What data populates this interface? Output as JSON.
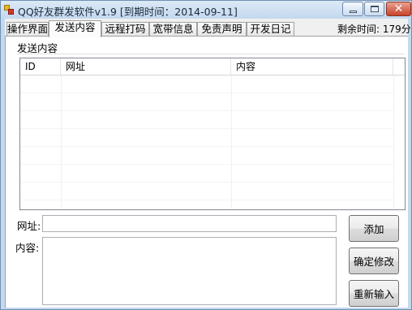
{
  "window": {
    "title": "QQ好友群发软件v1.9 [到期时间：2014-09-11]",
    "close_symbol": "✕"
  },
  "tabs": [
    {
      "label": "操作界面",
      "active": false
    },
    {
      "label": "发送内容",
      "active": true
    },
    {
      "label": "远程打码",
      "active": false
    },
    {
      "label": "宽带信息",
      "active": false
    },
    {
      "label": "免责声明",
      "active": false
    },
    {
      "label": "开发日记",
      "active": false
    }
  ],
  "remaining_time": "剩余时间: 179分",
  "send_content": {
    "group_label": "发送内容",
    "columns": [
      "ID",
      "网址",
      "内容"
    ],
    "rows": []
  },
  "form": {
    "url_label": "网址:",
    "url_value": "",
    "content_label": "内容:",
    "content_value": ""
  },
  "buttons": {
    "add": "添加",
    "confirm_edit": "确定修改",
    "reset_input": "重新输入"
  }
}
